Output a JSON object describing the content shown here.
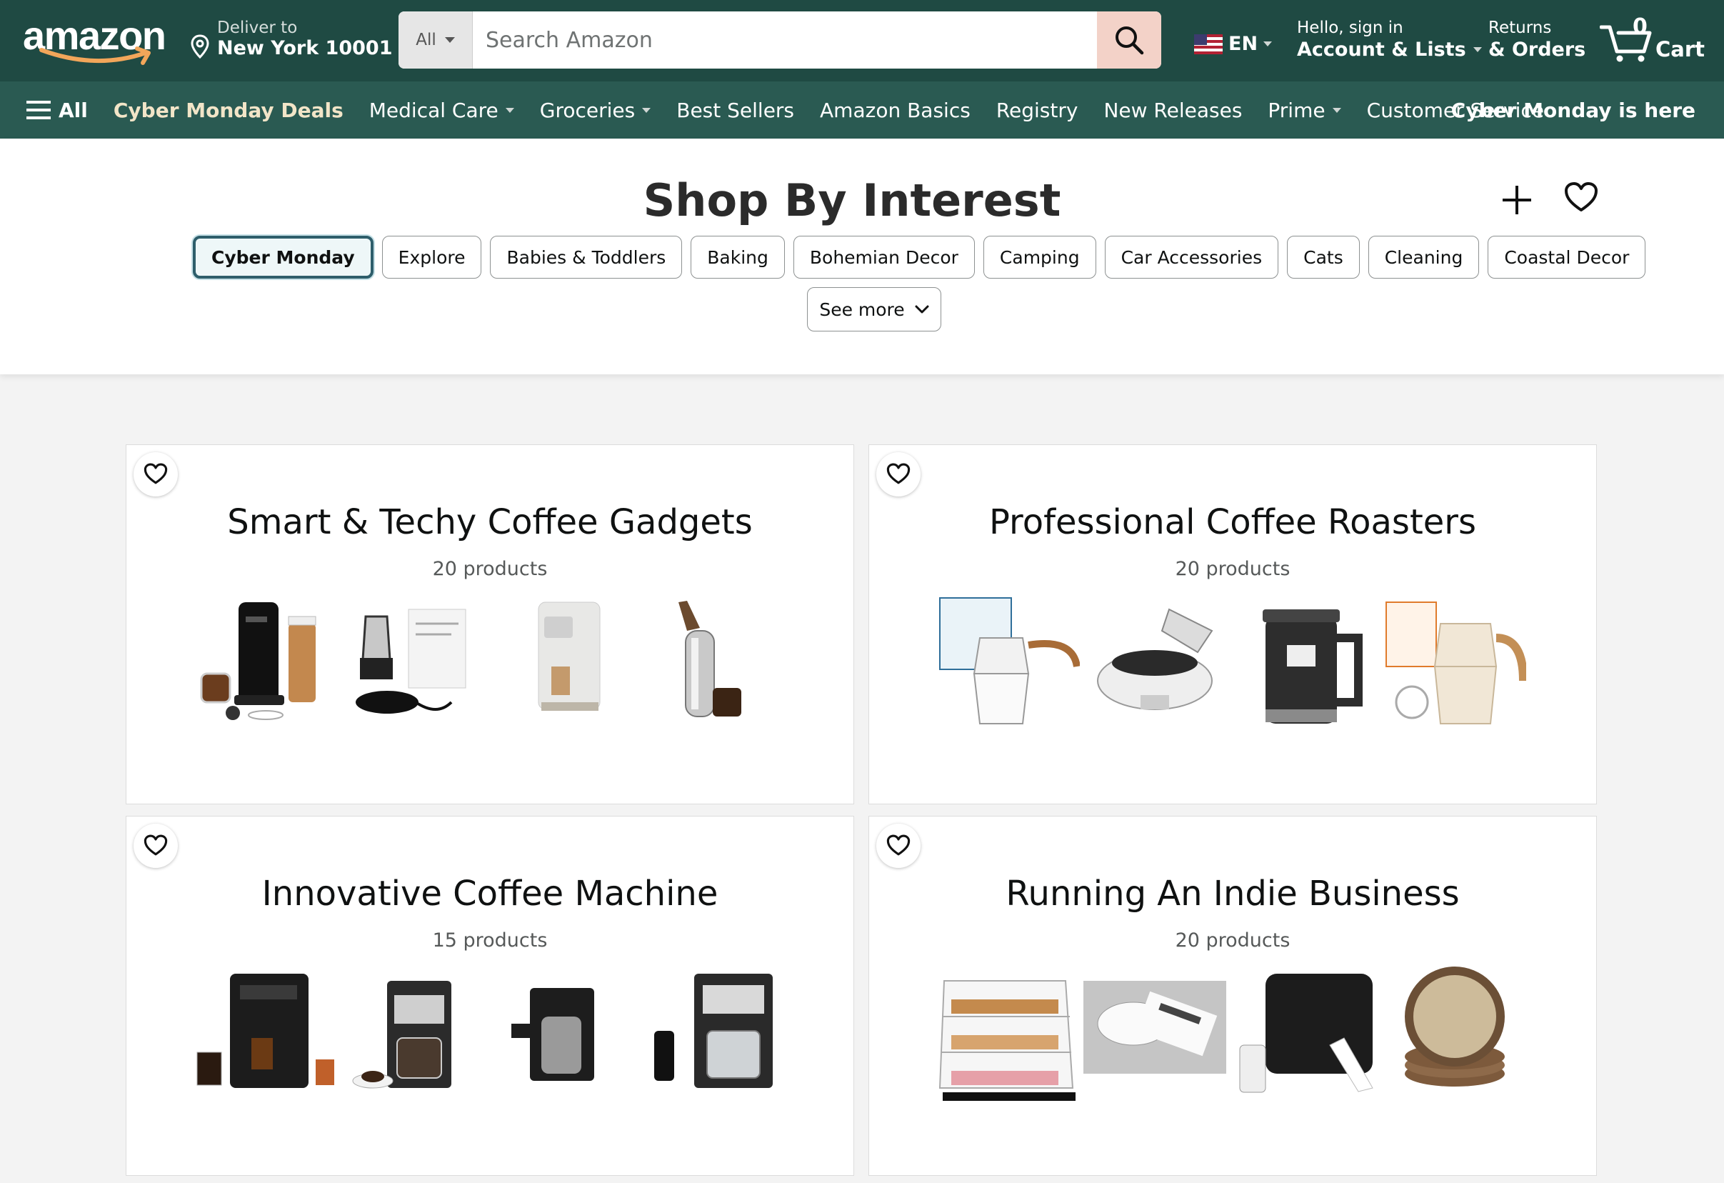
{
  "header": {
    "logo_text": "amazon",
    "deliver_line1": "Deliver to",
    "deliver_line2": "New York 10001",
    "search_category": "All",
    "search_placeholder": "Search Amazon",
    "language": "EN",
    "account_line1": "Hello, sign in",
    "account_line2": "Account & Lists",
    "returns_line1": "Returns",
    "returns_line2": "& Orders",
    "cart_count": "0",
    "cart_label": "Cart"
  },
  "subnav": {
    "all": "All",
    "items": [
      {
        "label": "Cyber Monday Deals",
        "dropdown": false
      },
      {
        "label": "Medical Care",
        "dropdown": true
      },
      {
        "label": "Groceries",
        "dropdown": true
      },
      {
        "label": "Best Sellers",
        "dropdown": false
      },
      {
        "label": "Amazon Basics",
        "dropdown": false
      },
      {
        "label": "Registry",
        "dropdown": false
      },
      {
        "label": "New Releases",
        "dropdown": false
      },
      {
        "label": "Prime",
        "dropdown": true
      },
      {
        "label": "Customer Service",
        "dropdown": false
      }
    ],
    "promo": "Cyber Monday is here"
  },
  "interest": {
    "title": "Shop By Interest",
    "pills": [
      "Cyber Monday",
      "Explore",
      "Babies & Toddlers",
      "Baking",
      "Bohemian Decor",
      "Camping",
      "Car Accessories",
      "Cats",
      "Cleaning",
      "Coastal Decor"
    ],
    "active_pill": "Cyber Monday",
    "see_more": "See more"
  },
  "cards": [
    {
      "title": "Smart & Techy Coffee Gadgets",
      "count": "20 products",
      "thumbs": [
        "coffee-maker-with-cups",
        "stovetop-espresso-kit",
        "capsule-espresso-machine",
        "whipped-cream-dispenser"
      ]
    },
    {
      "title": "Professional Coffee Roasters",
      "count": "20 products",
      "thumbs": [
        "moka-pot-with-box",
        "electric-coffee-roaster",
        "french-press",
        "cream-moka-pot"
      ]
    },
    {
      "title": "Innovative Coffee Machine",
      "count": "15 products",
      "thumbs": [
        "super-automatic-espresso",
        "grind-and-brew-maker",
        "thermal-carafe-brewer",
        "smart-drip-coffee-maker"
      ]
    },
    {
      "title": "Running An Indie Business",
      "count": "20 products",
      "thumbs": [
        "pastry-display-case",
        "barcode-label-roll",
        "label-printer",
        "ceramic-plate-stack"
      ]
    }
  ],
  "colors": {
    "header_bg": "#1f4a43",
    "subnav_bg": "#2a5a52",
    "search_button": "#f3d2c8",
    "active_pill_border": "#2e5e6b"
  }
}
